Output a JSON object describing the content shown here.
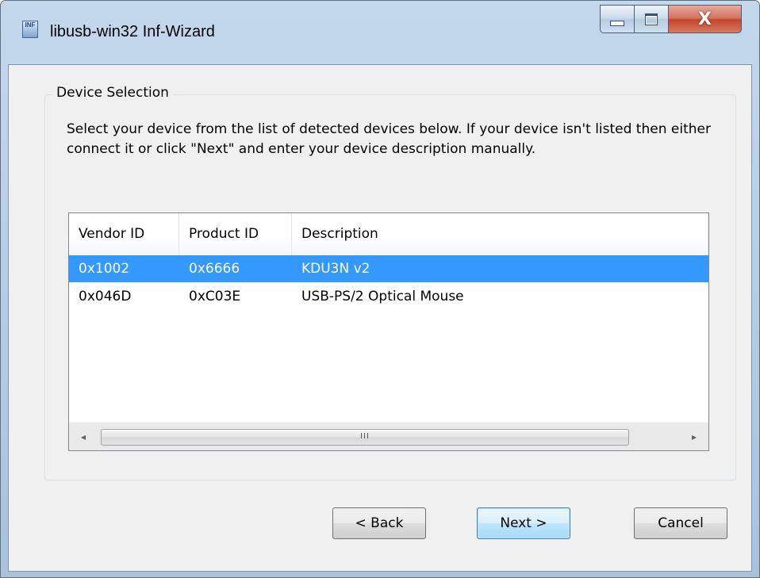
{
  "window": {
    "title": "libusb-win32 Inf-Wizard",
    "icon_text": "INF",
    "controls": {
      "minimize_icon": "minimize-icon",
      "maximize_icon": "maximize-icon",
      "close_icon": "close-icon",
      "close_glyph": "X"
    }
  },
  "group": {
    "legend": "Device Selection",
    "instructions": "Select your device from the list of detected devices below. If your device isn't listed then either connect it or click \"Next\" and enter your device description manually."
  },
  "device_list": {
    "columns": [
      "Vendor ID",
      "Product ID",
      "Description"
    ],
    "rows": [
      {
        "vendor_id": "0x1002",
        "product_id": "0x6666",
        "description": "KDU3N v2",
        "selected": true
      },
      {
        "vendor_id": "0x046D",
        "product_id": "0xC03E",
        "description": "USB-PS/2 Optical Mouse",
        "selected": false
      }
    ],
    "scrollbar": {
      "left_arrow": "◂",
      "right_arrow": "▸",
      "thumb_grip": "III"
    }
  },
  "buttons": {
    "back": "< Back",
    "next": "Next >",
    "cancel": "Cancel"
  },
  "colors": {
    "selection": "#3399ff",
    "dialog_bg": "#f0f0f0",
    "close_button": "#c2452c"
  }
}
